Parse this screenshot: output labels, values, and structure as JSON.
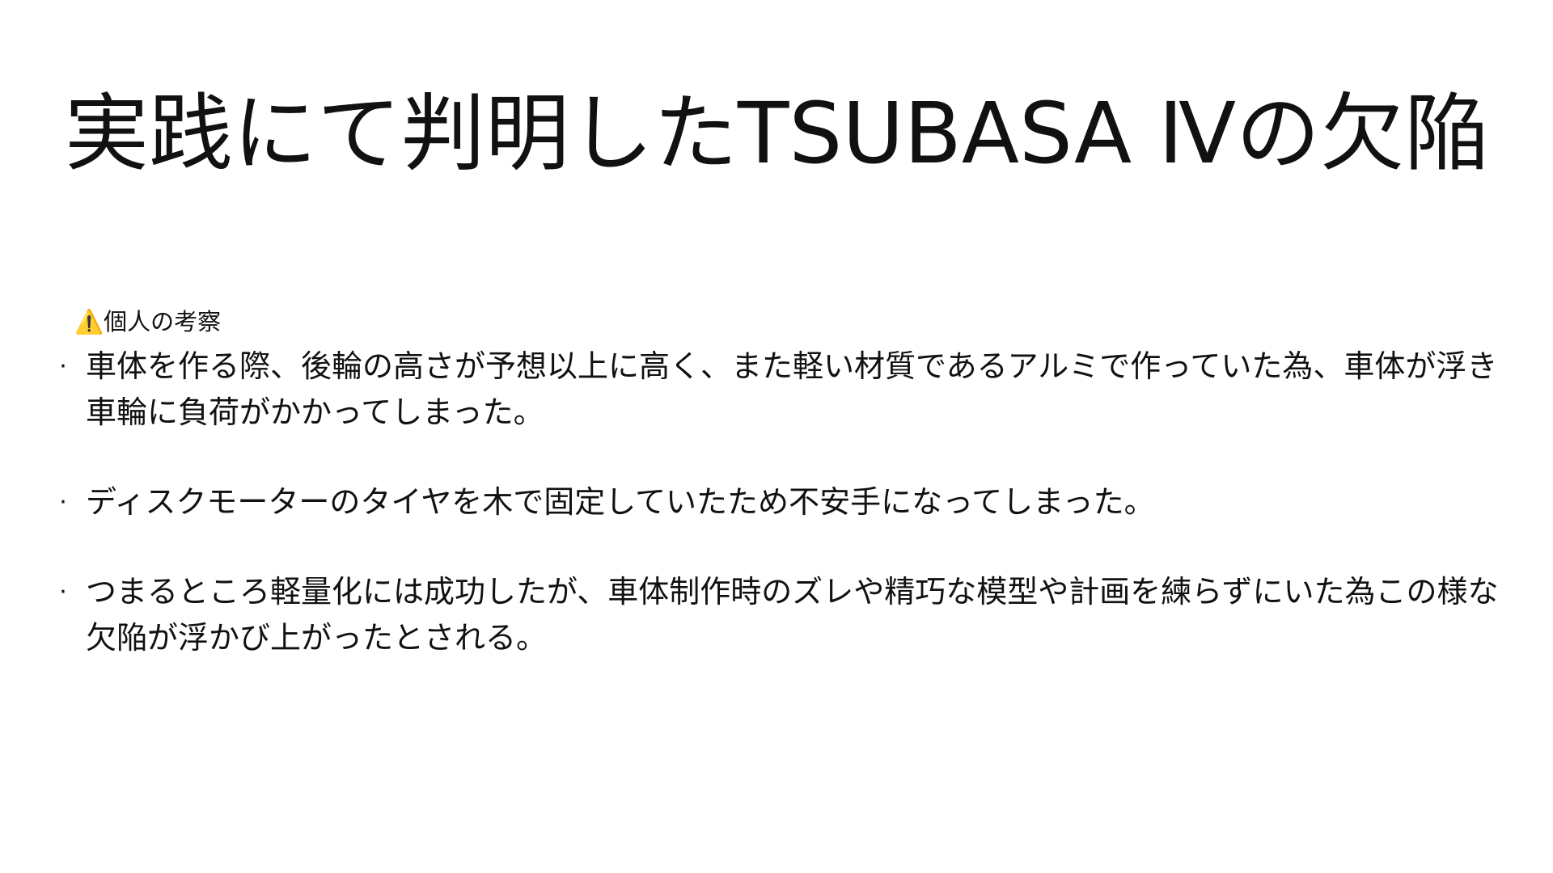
{
  "slide": {
    "title": "実践にて判明したTSUBASA Ⅳの欠陥",
    "note": "⚠️個人の考察",
    "bullets": [
      {
        "marker": "·",
        "text": "車体を作る際、後輪の高さが予想以上に高く、また軽い材質であるアルミで作っていた為、車体が浮き車輪に負荷がかかってしまった。"
      },
      {
        "marker": "·",
        "text": "ディスクモーターのタイヤを木で固定していたため不安手になってしまった。"
      },
      {
        "marker": "·",
        "text": "つまるところ軽量化には成功したが、車体制作時のズレや精巧な模型や計画を練らずにいた為この様な欠陥が浮かび上がったとされる。"
      }
    ]
  }
}
